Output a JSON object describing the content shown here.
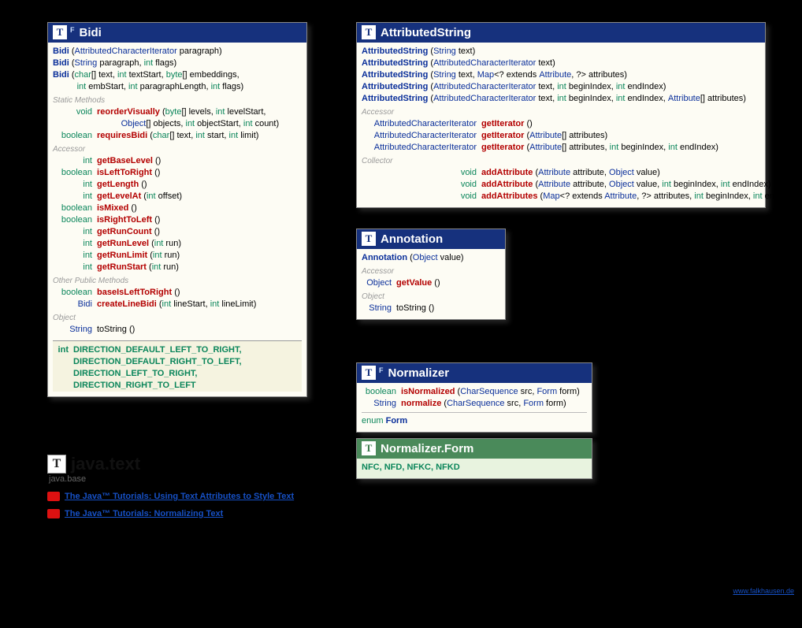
{
  "package": {
    "icon": "T",
    "name": "java.text",
    "module": "java.base"
  },
  "tutorials": [
    "The Java™ Tutorials: Using Text Attributes to Style Text",
    "The Java™ Tutorials: Normalizing Text"
  ],
  "watermark": "www.falkhausen.de",
  "bidi": {
    "title": "Bidi",
    "ctors": [
      [
        [
          "t-new",
          "Bidi"
        ],
        [
          "",
          ""
        ],
        [
          "",
          " ("
        ],
        [
          "t-link",
          "AttributedCharacterIterator"
        ],
        [
          "",
          " paragraph)"
        ]
      ],
      [
        [
          "t-new",
          "Bidi"
        ],
        [
          "",
          " ("
        ],
        [
          "t-link",
          "String"
        ],
        [
          "",
          " paragraph, "
        ],
        [
          "t-kw",
          "int"
        ],
        [
          "",
          " flags)"
        ]
      ],
      [
        [
          "t-new",
          "Bidi"
        ],
        [
          "",
          " ("
        ],
        [
          "t-kw",
          "char"
        ],
        [
          "",
          "[] text, "
        ],
        [
          "t-kw",
          "int"
        ],
        [
          "",
          " textStart, "
        ],
        [
          "t-kw",
          "byte"
        ],
        [
          "",
          "[] embeddings,"
        ]
      ],
      [
        [
          "",
          "          "
        ],
        [
          "t-kw",
          "int"
        ],
        [
          "",
          " embStart, "
        ],
        [
          "t-kw",
          "int"
        ],
        [
          "",
          " paragraphLength, "
        ],
        [
          "t-kw",
          "int"
        ],
        [
          "",
          " flags)"
        ]
      ]
    ],
    "sec_static": "Static Methods",
    "static_rows": [
      {
        "ret": "void",
        "retc": "t-kw",
        "sig": [
          [
            "t-name",
            "reorderVisually"
          ],
          [
            "",
            " ("
          ],
          [
            "t-kw",
            "byte"
          ],
          [
            "",
            "[] levels, "
          ],
          [
            "t-kw",
            "int"
          ],
          [
            "",
            " levelStart,"
          ]
        ]
      },
      {
        "ret": "",
        "retc": "",
        "sig": [
          [
            "",
            "          "
          ],
          [
            "t-link",
            "Object"
          ],
          [
            "",
            "[] objects, "
          ],
          [
            "t-kw",
            "int"
          ],
          [
            "",
            " objectStart, "
          ],
          [
            "t-kw",
            "int"
          ],
          [
            "",
            " count)"
          ]
        ]
      },
      {
        "ret": "boolean",
        "retc": "t-kw",
        "sig": [
          [
            "t-name",
            "requiresBidi"
          ],
          [
            "",
            " ("
          ],
          [
            "t-kw",
            "char"
          ],
          [
            "",
            "[] text, "
          ],
          [
            "t-kw",
            "int"
          ],
          [
            "",
            " start, "
          ],
          [
            "t-kw",
            "int"
          ],
          [
            "",
            " limit)"
          ]
        ]
      }
    ],
    "sec_accessor": "Accessor",
    "accessor_rows": [
      {
        "ret": "int",
        "retc": "t-kw",
        "sig": [
          [
            "t-name",
            "getBaseLevel"
          ],
          [
            "",
            " ()"
          ]
        ]
      },
      {
        "ret": "boolean",
        "retc": "t-kw",
        "sig": [
          [
            "t-name",
            "isLeftToRight"
          ],
          [
            "",
            " ()"
          ]
        ]
      },
      {
        "ret": "int",
        "retc": "t-kw",
        "sig": [
          [
            "t-name",
            "getLength"
          ],
          [
            "",
            " ()"
          ]
        ]
      },
      {
        "ret": "int",
        "retc": "t-kw",
        "sig": [
          [
            "t-name",
            "getLevelAt"
          ],
          [
            "",
            " ("
          ],
          [
            "t-kw",
            "int"
          ],
          [
            "",
            " offset)"
          ]
        ]
      },
      {
        "ret": "boolean",
        "retc": "t-kw",
        "sig": [
          [
            "t-name",
            "isMixed"
          ],
          [
            "",
            " ()"
          ]
        ]
      },
      {
        "ret": "boolean",
        "retc": "t-kw",
        "sig": [
          [
            "t-name",
            "isRightToLeft"
          ],
          [
            "",
            " ()"
          ]
        ]
      },
      {
        "ret": "int",
        "retc": "t-kw",
        "sig": [
          [
            "t-name",
            "getRunCount"
          ],
          [
            "",
            " ()"
          ]
        ]
      },
      {
        "ret": "int",
        "retc": "t-kw",
        "sig": [
          [
            "t-name",
            "getRunLevel"
          ],
          [
            "",
            " ("
          ],
          [
            "t-kw",
            "int"
          ],
          [
            "",
            " run)"
          ]
        ]
      },
      {
        "ret": "int",
        "retc": "t-kw",
        "sig": [
          [
            "t-name",
            "getRunLimit"
          ],
          [
            "",
            " ("
          ],
          [
            "t-kw",
            "int"
          ],
          [
            "",
            " run)"
          ]
        ]
      },
      {
        "ret": "int",
        "retc": "t-kw",
        "sig": [
          [
            "t-name",
            "getRunStart"
          ],
          [
            "",
            " ("
          ],
          [
            "t-kw",
            "int"
          ],
          [
            "",
            " run)"
          ]
        ]
      }
    ],
    "sec_other": "Other Public Methods",
    "other_rows": [
      {
        "ret": "boolean",
        "retc": "t-kw",
        "sig": [
          [
            "t-name",
            "baseIsLeftToRight"
          ],
          [
            "",
            " ()"
          ]
        ]
      },
      {
        "ret": "Bidi",
        "retc": "t-link",
        "sig": [
          [
            "t-name",
            "createLineBidi"
          ],
          [
            "",
            " ("
          ],
          [
            "t-kw",
            "int"
          ],
          [
            "",
            " lineStart, "
          ],
          [
            "t-kw",
            "int"
          ],
          [
            "",
            " lineLimit)"
          ]
        ]
      }
    ],
    "sec_object": "Object",
    "object_rows": [
      {
        "ret": "String",
        "retc": "t-link",
        "sig": [
          [
            "",
            "toString ()"
          ]
        ]
      }
    ],
    "consts_ret": "int",
    "consts": [
      "DIRECTION_DEFAULT_LEFT_TO_RIGHT,",
      "DIRECTION_DEFAULT_RIGHT_TO_LEFT,",
      "DIRECTION_LEFT_TO_RIGHT,",
      "DIRECTION_RIGHT_TO_LEFT"
    ]
  },
  "attrstr": {
    "title": "AttributedString",
    "ctors": [
      [
        [
          "t-new",
          "AttributedString"
        ],
        [
          "",
          " ("
        ],
        [
          "t-link",
          "String"
        ],
        [
          "",
          " text)"
        ]
      ],
      [
        [
          "t-new",
          "AttributedString"
        ],
        [
          "",
          " ("
        ],
        [
          "t-link",
          "AttributedCharacterIterator"
        ],
        [
          "",
          " text)"
        ]
      ],
      [
        [
          "t-new",
          "AttributedString"
        ],
        [
          "",
          " ("
        ],
        [
          "t-link",
          "String"
        ],
        [
          "",
          " text, "
        ],
        [
          "t-link",
          "Map"
        ],
        [
          "",
          "<? extends "
        ],
        [
          "t-link",
          "Attribute"
        ],
        [
          "",
          ", ?> attributes)"
        ]
      ],
      [
        [
          "t-new",
          "AttributedString"
        ],
        [
          "",
          " ("
        ],
        [
          "t-link",
          "AttributedCharacterIterator"
        ],
        [
          "",
          " text, "
        ],
        [
          "t-kw",
          "int"
        ],
        [
          "",
          " beginIndex, "
        ],
        [
          "t-kw",
          "int"
        ],
        [
          "",
          " endIndex)"
        ]
      ],
      [
        [
          "t-new",
          "AttributedString"
        ],
        [
          "",
          " ("
        ],
        [
          "t-link",
          "AttributedCharacterIterator"
        ],
        [
          "",
          " text, "
        ],
        [
          "t-kw",
          "int"
        ],
        [
          "",
          " beginIndex, "
        ],
        [
          "t-kw",
          "int"
        ],
        [
          "",
          " endIndex, "
        ],
        [
          "t-link",
          "Attribute"
        ],
        [
          "",
          "[] attributes)"
        ]
      ]
    ],
    "sec_accessor": "Accessor",
    "accessor_rows": [
      {
        "ret": "AttributedCharacterIterator",
        "retc": "t-link",
        "sig": [
          [
            "t-name",
            "getIterator"
          ],
          [
            "",
            " ()"
          ]
        ]
      },
      {
        "ret": "AttributedCharacterIterator",
        "retc": "t-link",
        "sig": [
          [
            "t-name",
            "getIterator"
          ],
          [
            "",
            " ("
          ],
          [
            "t-link",
            "Attribute"
          ],
          [
            "",
            "[] attributes)"
          ]
        ]
      },
      {
        "ret": "AttributedCharacterIterator",
        "retc": "t-link",
        "sig": [
          [
            "t-name",
            "getIterator"
          ],
          [
            "",
            " ("
          ],
          [
            "t-link",
            "Attribute"
          ],
          [
            "",
            "[] attributes, "
          ],
          [
            "t-kw",
            "int"
          ],
          [
            "",
            " beginIndex, "
          ],
          [
            "t-kw",
            "int"
          ],
          [
            "",
            " endIndex)"
          ]
        ]
      }
    ],
    "sec_collector": "Collector",
    "collector_rows": [
      {
        "ret": "void",
        "retc": "t-kw",
        "sig": [
          [
            "t-name",
            "addAttribute"
          ],
          [
            "",
            " ("
          ],
          [
            "t-link",
            "Attribute"
          ],
          [
            "",
            " attribute, "
          ],
          [
            "t-link",
            "Object"
          ],
          [
            "",
            " value)"
          ]
        ]
      },
      {
        "ret": "void",
        "retc": "t-kw",
        "sig": [
          [
            "t-name",
            "addAttribute"
          ],
          [
            "",
            " ("
          ],
          [
            "t-link",
            "Attribute"
          ],
          [
            "",
            " attribute, "
          ],
          [
            "t-link",
            "Object"
          ],
          [
            "",
            " value, "
          ],
          [
            "t-kw",
            "int"
          ],
          [
            "",
            " beginIndex, "
          ],
          [
            "t-kw",
            "int"
          ],
          [
            "",
            " endIndex)"
          ]
        ]
      },
      {
        "ret": "void",
        "retc": "t-kw",
        "sig": [
          [
            "t-name",
            "addAttributes"
          ],
          [
            "",
            " ("
          ],
          [
            "t-link",
            "Map"
          ],
          [
            "",
            "<? extends "
          ],
          [
            "t-link",
            "Attribute"
          ],
          [
            "",
            ", ?> attributes, "
          ],
          [
            "t-kw",
            "int"
          ],
          [
            "",
            " beginIndex, "
          ],
          [
            "t-kw",
            "int"
          ],
          [
            "",
            " endIndex)"
          ]
        ]
      }
    ]
  },
  "annotation": {
    "title": "Annotation",
    "ctors": [
      [
        [
          "t-new",
          "Annotation"
        ],
        [
          "",
          " ("
        ],
        [
          "t-link",
          "Object"
        ],
        [
          "",
          " value)"
        ]
      ]
    ],
    "sec_accessor": "Accessor",
    "accessor_rows": [
      {
        "ret": "Object",
        "retc": "t-link",
        "sig": [
          [
            "t-name",
            "getValue"
          ],
          [
            "",
            " ()"
          ]
        ]
      }
    ],
    "sec_object": "Object",
    "object_rows": [
      {
        "ret": "String",
        "retc": "t-link",
        "sig": [
          [
            "",
            "toString ()"
          ]
        ]
      }
    ]
  },
  "normalizer": {
    "title": "Normalizer",
    "rows": [
      {
        "ret": "boolean",
        "retc": "t-kw",
        "sig": [
          [
            "t-name",
            "isNormalized"
          ],
          [
            "",
            " ("
          ],
          [
            "t-link",
            "CharSequence"
          ],
          [
            "",
            " src, "
          ],
          [
            "t-link",
            "Form"
          ],
          [
            "",
            " form)"
          ]
        ]
      },
      {
        "ret": "String",
        "retc": "t-link",
        "sig": [
          [
            "t-name",
            "normalize"
          ],
          [
            "",
            " ("
          ],
          [
            "t-link",
            "CharSequence"
          ],
          [
            "",
            " src, "
          ],
          [
            "t-link",
            "Form"
          ],
          [
            "",
            " form)"
          ]
        ]
      }
    ],
    "enum_kw": "enum",
    "enum_type": "Form"
  },
  "normform": {
    "title": "Normalizer.Form",
    "values": "NFC, NFD, NFKC, NFKD"
  }
}
